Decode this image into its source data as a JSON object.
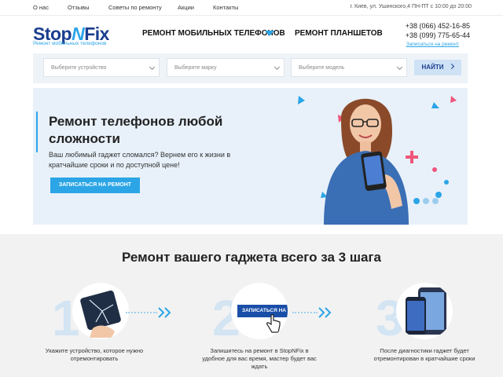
{
  "topbar": {
    "links": [
      "О нас",
      "Отзывы",
      "Советы по ремонту",
      "Акции",
      "Контакты"
    ],
    "address": "г. Киев, ул. Ушинского,4 ПН-ПТ с 10:00 до 20:00"
  },
  "header": {
    "logo_part1": "Stop",
    "logo_part2": "N",
    "logo_part3": "Fix",
    "logo_sub": "Ремонт мобильных телефонов",
    "menu": [
      "РЕМОНТ МОБИЛЬНЫХ ТЕЛЕФОНОВ",
      "РЕМОНТ ПЛАНШЕТОВ"
    ],
    "phones": [
      "+38 (066) 452-16-85",
      "+38 (099) 775-65-44"
    ],
    "callback": "Записаться на ремонт"
  },
  "filter": {
    "device_placeholder": "Выберите устройство",
    "brand_placeholder": "Выберите марку",
    "model_placeholder": "Выберите модель",
    "find_label": "НАЙТИ"
  },
  "hero": {
    "title": "Ремонт телефонов любой сложности",
    "text": "Ваш любимый гаджет сломался? Вернем его к жизни в кратчайшие сроки и по доступной цене!",
    "button": "ЗАПИСАТЬСЯ НА РЕМОНТ",
    "slider_dots": 3,
    "slider_active": 1
  },
  "steps": {
    "title": "Ремонт вашего гаджета всего за 3 шага",
    "items": [
      {
        "num": "1",
        "text": "Укажите устройство, которое нужно отремонтировать"
      },
      {
        "num": "2",
        "text": "Запишитесь на ремонт в StopNFix в удобное для вас время, мастер будет вас ждать",
        "button": "ЗАПИСАТЬСЯ НА РЕ"
      },
      {
        "num": "3",
        "text": "После диагностики гаджет будет отремонтирован в кратчайшие сроки"
      }
    ]
  },
  "colors": {
    "brand": "#1a3d8f",
    "accent": "#2ba5e6",
    "pink": "#f0567a"
  }
}
